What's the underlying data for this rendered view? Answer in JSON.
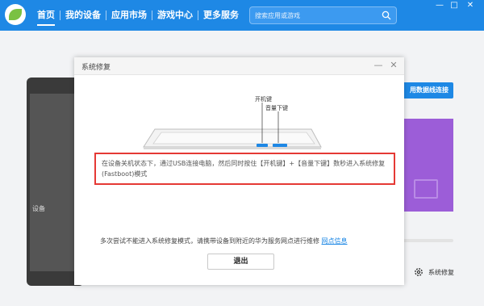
{
  "topbar": {
    "nav": [
      {
        "label": "首页"
      },
      {
        "label": "我的设备"
      },
      {
        "label": "应用市场"
      },
      {
        "label": "游戏中心"
      },
      {
        "label": "更多服务"
      }
    ],
    "search_placeholder": "搜索应用或游戏",
    "window_controls": {
      "minimize": "—",
      "maximize": "□",
      "close": "✕"
    }
  },
  "background": {
    "tablet_text": "设备",
    "wireless_button": "用数据线连接",
    "system_repair_link": "系统修复"
  },
  "dialog": {
    "title": "系统修复",
    "minimize": "—",
    "close": "✕",
    "power_key_label": "开机键",
    "volume_down_label": "音量下键",
    "instruction": "在设备关机状态下，通过USB连接电脑，然后同时按住【开机键】+【音量下键】数秒进入系统修复(Fastboot)模式",
    "footer_note": "多次尝试不能进入系统修复模式，请携带设备到附近的华为服务网点进行维修",
    "footer_link": "网点信息",
    "exit_button": "退出"
  }
}
